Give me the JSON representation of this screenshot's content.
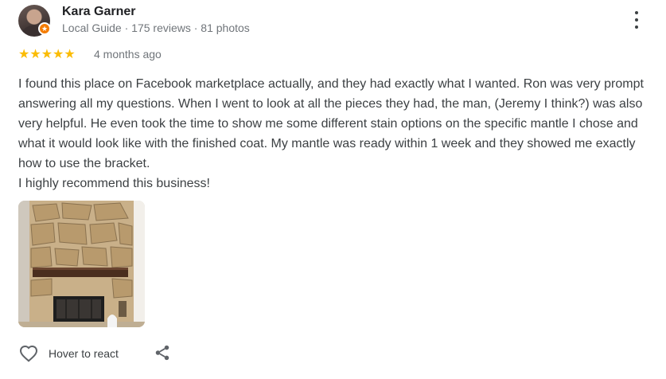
{
  "reviewer": {
    "name": "Kara Garner",
    "meta": "Local Guide · 175 reviews · 81 photos",
    "badge_icon": "local-guide-star-icon"
  },
  "rating": {
    "stars": 5,
    "stars_text": "★★★★★",
    "time": "4 months ago",
    "star_color": "#fbbc04"
  },
  "review": {
    "text": "I found this place on Facebook marketplace actually, and they had exactly what I wanted. Ron was very prompt answering all my questions. When I went to look at all the pieces they had, the man, (Jeremy I think?) was also very helpful. He even took the time to show me some different stain options on the specific mantle I chose and what it would look like with the finished coat. My mantle was ready within 1 week and they showed me exactly how to use the bracket.\nI highly recommend this business!"
  },
  "actions": {
    "react_label": "Hover to react",
    "react_icon": "heart-outline-icon",
    "share_icon": "share-icon",
    "more_icon": "more-vert-icon"
  },
  "colors": {
    "accent_badge": "#f57c00",
    "meta_text": "#70757a"
  }
}
